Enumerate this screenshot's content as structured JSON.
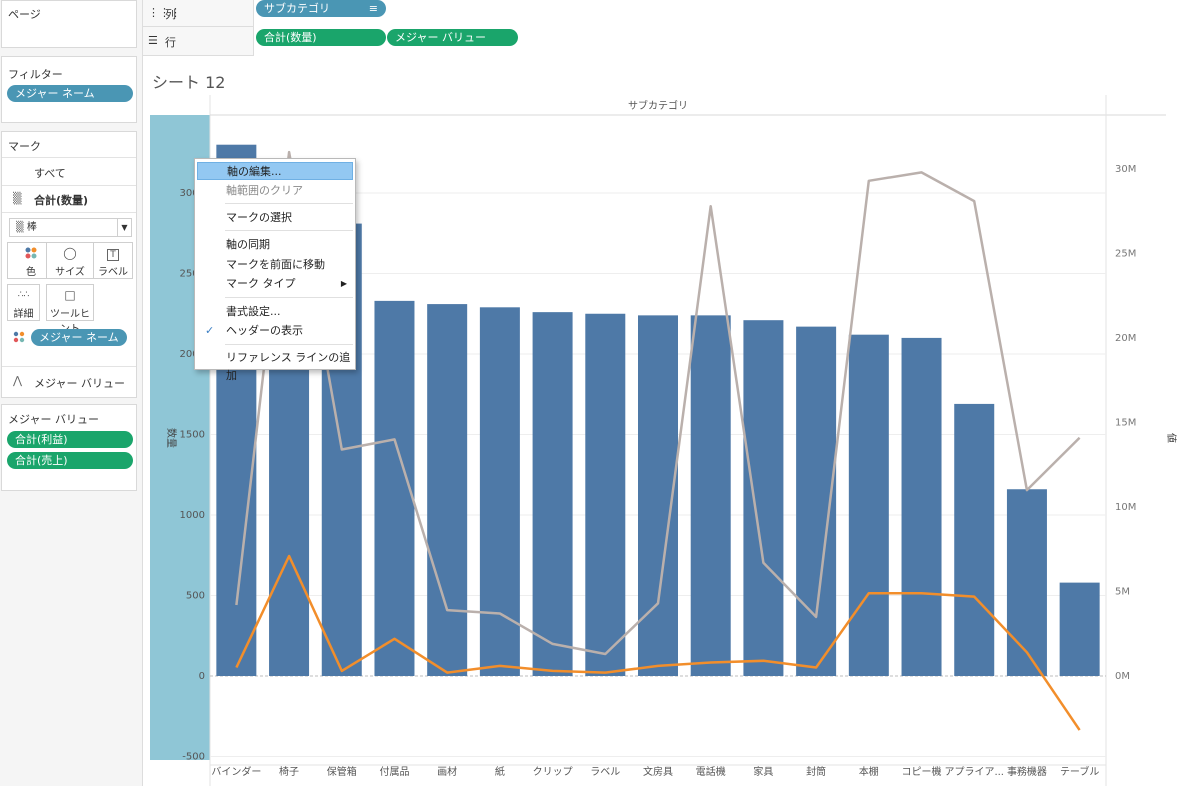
{
  "left": {
    "pages_title": "ページ",
    "filters_title": "フィルター",
    "filters": [
      "メジャー ネーム"
    ],
    "marks_title": "マーク",
    "all_label": "すべて",
    "measure_label": "合計(数量)",
    "mark_type": "棒",
    "buttons": [
      {
        "label": "色",
        "icon": "color-dots-icon"
      },
      {
        "label": "サイズ",
        "icon": "size-icon"
      },
      {
        "label": "ラベル",
        "icon": "label-icon"
      },
      {
        "label": "詳細",
        "icon": "detail-icon"
      },
      {
        "label": "ツールヒント",
        "icon": "tooltip-icon"
      }
    ],
    "color_pill": "メジャー ネーム",
    "measure_values_row": "メジャー バリュー",
    "mv_title": "メジャー バリュー",
    "mv_items": [
      "合計(利益)",
      "合計(売上)"
    ]
  },
  "shelves": {
    "columns_label": "列",
    "columns_pill": "サブカテゴリ",
    "rows_label": "行",
    "rows_pills": [
      "合計(数量)",
      "メジャー バリュー"
    ]
  },
  "sheet_title": "シート 12",
  "context_menu": {
    "items": [
      {
        "label": "軸の編集...",
        "state": "highlighted"
      },
      {
        "label": "軸範囲のクリア",
        "state": "disabled"
      },
      {
        "label": "マークの選択",
        "state": "normal"
      },
      {
        "label": "軸の同期",
        "state": "normal"
      },
      {
        "label": "マークを前面に移動",
        "state": "normal"
      },
      {
        "label": "マーク タイプ",
        "state": "submenu"
      },
      {
        "label": "書式設定...",
        "state": "normal"
      },
      {
        "label": "ヘッダーの表示",
        "state": "checked"
      },
      {
        "label": "リファレンス ラインの追加",
        "state": "normal"
      }
    ]
  },
  "chart_data": {
    "type": "bar",
    "header": "サブカテゴリ",
    "ylabel": "数量",
    "y2label": "値",
    "ylim": [
      -500,
      3300
    ],
    "y_ticks": [
      -500,
      0,
      500,
      1000,
      1500,
      2000,
      2500,
      3000
    ],
    "y_tick_labels": [
      "-500",
      "0",
      "500",
      "1000",
      "1500",
      "2000",
      "2500",
      "3000"
    ],
    "y2lim": [
      -4,
      31.5
    ],
    "y2_ticks": [
      0,
      5,
      10,
      15,
      20,
      25,
      30
    ],
    "y2_tick_labels": [
      "0M",
      "5M",
      "10M",
      "15M",
      "20M",
      "25M",
      "30M"
    ],
    "categories": [
      "バインダー",
      "椅子",
      "保管箱",
      "付属品",
      "画材",
      "紙",
      "クリップ",
      "ラベル",
      "文房具",
      "電話機",
      "家具",
      "封筒",
      "本棚",
      "コピー機",
      "アプライア...",
      "事務機器",
      "テーブル"
    ],
    "bar_series": {
      "name": "合計(数量)",
      "color": "#4e79a7",
      "values": [
        3300,
        2600,
        2810,
        2330,
        2310,
        2290,
        2260,
        2250,
        2240,
        2240,
        2210,
        2170,
        2120,
        2100,
        1690,
        1160,
        580
      ]
    },
    "line_series": [
      {
        "name": "合計(売上)",
        "color": "#bab0ac",
        "values": [
          4.2,
          31.0,
          13.4,
          14.0,
          3.9,
          3.7,
          1.9,
          1.3,
          4.3,
          27.8,
          6.7,
          3.5,
          29.3,
          29.8,
          28.1,
          11.0,
          14.1
        ]
      },
      {
        "name": "合計(利益)",
        "color": "#f28e2b",
        "values": [
          0.5,
          7.1,
          0.3,
          2.2,
          0.2,
          0.6,
          0.3,
          0.2,
          0.6,
          0.8,
          0.9,
          0.5,
          4.9,
          4.9,
          4.7,
          1.4,
          -3.2
        ]
      }
    ]
  }
}
